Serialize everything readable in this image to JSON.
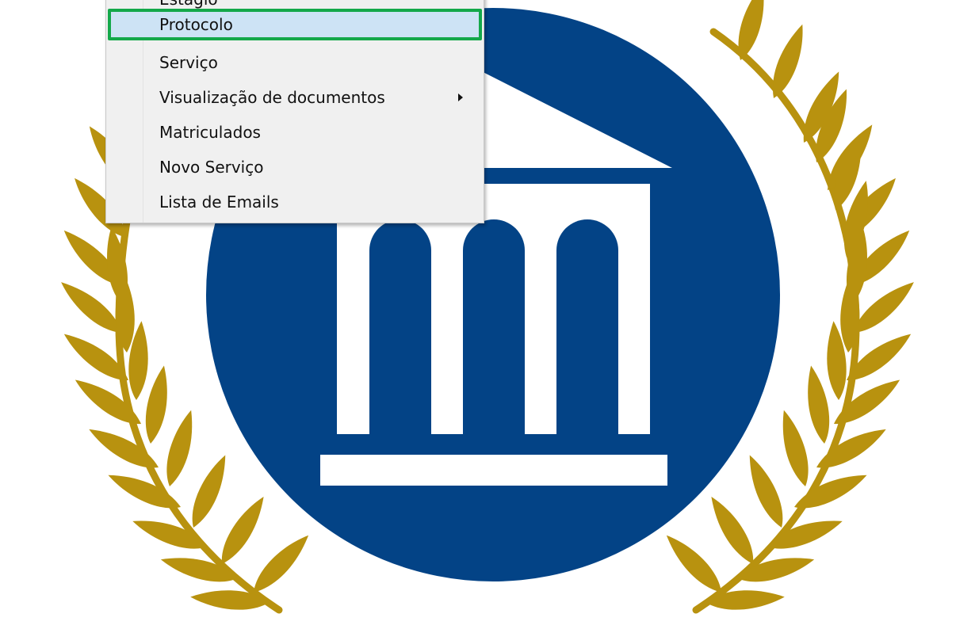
{
  "menu": {
    "items": [
      {
        "label": "Estágio"
      },
      {
        "label": "Protocolo"
      },
      {
        "label": "Serviço"
      },
      {
        "label": "Visualização de documentos"
      },
      {
        "label": "Matriculados"
      },
      {
        "label": "Novo Serviço"
      },
      {
        "label": "Lista de Emails"
      }
    ],
    "selected": "Protocolo",
    "submenu_item": "Visualização de documentos"
  },
  "logo": {
    "icon": "institution-icon",
    "laurel_icon": "laurel-wreath-icon",
    "colors": {
      "circle": "#034386",
      "laurel": "#b8920f",
      "building": "#ffffff",
      "highlight_border": "#14a84a",
      "highlight_fill": "#cde3f5"
    }
  }
}
